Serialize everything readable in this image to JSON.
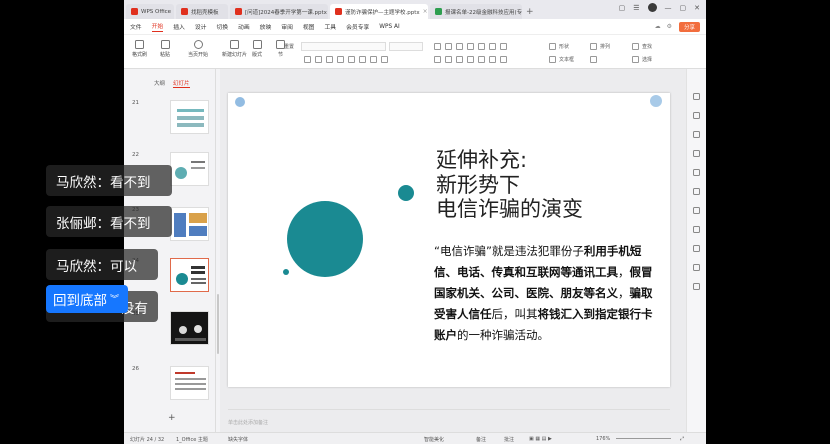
{
  "tabs": [
    {
      "label": "WPS Office",
      "color": "#e0301e",
      "active": false
    },
    {
      "label": "找稻壳模板",
      "color": "#e0301e",
      "active": false
    },
    {
      "label": "[问道]2024春季开学第一课.pptx",
      "color": "#e0301e",
      "active": false
    },
    {
      "label": "谨防诈骗保护—主题学校.pptx",
      "color": "#e0301e",
      "active": true
    },
    {
      "label": "报课名单-22级金融科技应用(专)...",
      "color": "#2e9e4f",
      "active": false
    }
  ],
  "menu": {
    "items": [
      "文件",
      "开始",
      "插入",
      "设计",
      "切换",
      "动画",
      "放映",
      "审阅",
      "视图",
      "工具",
      "会员专享",
      "WPS AI"
    ],
    "active": "开始",
    "share": "分享"
  },
  "ribbon": {
    "format_painter": "格式刷",
    "paste": "粘贴",
    "from_current": "当页开始",
    "new_slide": "新建幻灯片",
    "layout": "版式",
    "section": "节",
    "reset": "重置",
    "shape": "形状",
    "arrange": "排列",
    "textbox": "文本框",
    "find": "查找",
    "select": "选择"
  },
  "left_panel": {
    "tabs": [
      "大纲",
      "幻灯片"
    ],
    "active_tab": "幻灯片",
    "slides": [
      {
        "num": "21",
        "selected": false
      },
      {
        "num": "22",
        "selected": false
      },
      {
        "num": "23",
        "selected": false
      },
      {
        "num": "24",
        "selected": true
      },
      {
        "num": "25",
        "selected": false
      },
      {
        "num": "26",
        "selected": false
      }
    ],
    "add": "+"
  },
  "slide": {
    "title_lines": [
      "延伸补充:",
      "新形势下",
      "电信诈骗的演变"
    ],
    "body_segments": [
      {
        "text": "“电信诈骗”就是违法犯罪份子",
        "bold": false
      },
      {
        "text": "利用手机短信、电话、传真和互联网等通讯工具",
        "bold": true
      },
      {
        "text": "，",
        "bold": false
      },
      {
        "text": "假冒国家机关、公司、医院、朋友等名义",
        "bold": true
      },
      {
        "text": "，",
        "bold": false
      },
      {
        "text": "骗取受害人信任",
        "bold": true
      },
      {
        "text": "后，叫其",
        "bold": false
      },
      {
        "text": "将钱汇入到指定银行卡账户",
        "bold": true
      },
      {
        "text": "的一种诈骗活动。",
        "bold": false
      }
    ],
    "accent_color": "#1a8a92"
  },
  "notes_placeholder": "单击此处添加备注",
  "status": {
    "slide_count": "幻灯片 24 / 32",
    "theme": "1_Office 主题",
    "font_missing": "缺失字体",
    "beautify": "智能美化",
    "notes": "备注",
    "comments": "批注",
    "zoom": "176%"
  },
  "comments": [
    {
      "user": "马欣然",
      "text": "看不到"
    },
    {
      "user": "张俪邺",
      "text": "看不到"
    },
    {
      "user": "马欣然",
      "text": "可以"
    },
    {
      "user": "",
      "text": "没有"
    }
  ],
  "back_to_bottom": "回到底部"
}
